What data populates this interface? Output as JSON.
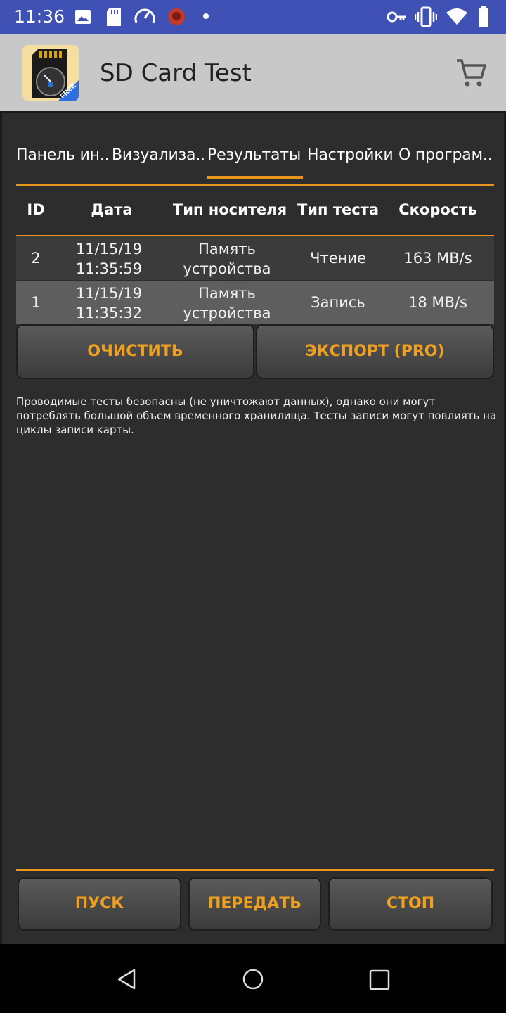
{
  "status_bar": {
    "time": "11:36",
    "left_icons": [
      "image-icon",
      "sd-card-icon",
      "speedometer-icon",
      "app-notification-icon",
      "dot-icon"
    ],
    "right_icons": [
      "key-icon",
      "vibrate-icon",
      "wifi-icon",
      "battery-icon"
    ],
    "bg_color": "#3f51b5"
  },
  "app_bar": {
    "title": "SD Card Test",
    "logo_badge": "FREE",
    "cart_icon": "shopping-cart-icon"
  },
  "tabs": [
    {
      "label": "Панель ин..",
      "active": false
    },
    {
      "label": "Визуализа..",
      "active": false
    },
    {
      "label": "Результаты",
      "active": true
    },
    {
      "label": "Настройки",
      "active": false
    },
    {
      "label": "О програм..",
      "active": false
    }
  ],
  "table": {
    "headers": [
      "ID",
      "Дата",
      "Тип носителя",
      "Тип теста",
      "Скорость"
    ],
    "rows": [
      {
        "id": "2",
        "date": "11/15/19",
        "time": "11:35:59",
        "media_1": "Память",
        "media_2": "устройства",
        "test": "Чтение",
        "speed": "163 MB/s"
      },
      {
        "id": "1",
        "date": "11/15/19",
        "time": "11:35:32",
        "media_1": "Память",
        "media_2": "устройства",
        "test": "Запись",
        "speed": "18 MB/s"
      }
    ]
  },
  "actions": {
    "clear": "ОЧИСТИТЬ",
    "export": "ЭКСПОРТ (PRO)"
  },
  "note": "Проводимые тесты безопасны (не уничтожают данных), однако они могут потреблять большой объем временного хранилища. Тесты записи могут повлиять на циклы записи карты.",
  "bottom_buttons": {
    "start": "ПУСК",
    "transfer": "ПЕРЕДАТЬ",
    "stop": "СТОП"
  },
  "accent_color": "#e8951c",
  "nav_bar": [
    "back-icon",
    "home-icon",
    "recents-icon"
  ]
}
